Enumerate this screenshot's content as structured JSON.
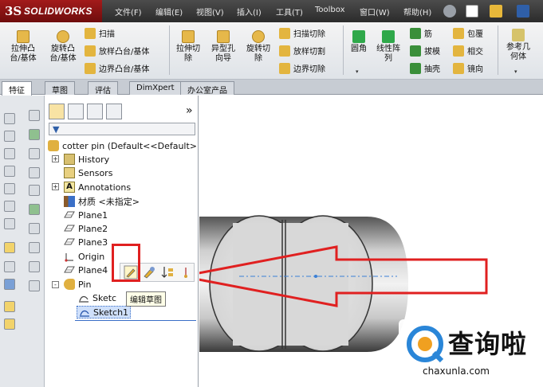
{
  "app": {
    "brand": "SOLIDWORKS",
    "brand_mark": "3S"
  },
  "menu": [
    {
      "label": "文件(F)"
    },
    {
      "label": "编辑(E)"
    },
    {
      "label": "视图(V)"
    },
    {
      "label": "插入(I)"
    },
    {
      "label": "工具(T)"
    },
    {
      "label": "Toolbox"
    },
    {
      "label": "窗口(W)"
    },
    {
      "label": "帮助(H)"
    }
  ],
  "ribbon": {
    "extrude_boss": "拉伸凸\n台/基体",
    "revolve_boss": "旋转凸\n台/基体",
    "sweep": "扫描",
    "loft_boss": "放样凸台/基体",
    "boundary_boss": "边界凸台/基体",
    "extrude_cut": "拉伸切\n除",
    "hole_wizard": "异型孔\n向导",
    "revolve_cut": "旋转切\n除",
    "sweep_cut": "扫描切除",
    "loft_cut": "放样切割",
    "boundary_cut": "边界切除",
    "fillet": "圆角",
    "linear_pattern": "线性阵\n列",
    "rib": "筋",
    "draft": "拔模",
    "shell": "抽壳",
    "wrap": "包覆",
    "intersect": "相交",
    "mirror": "镜向",
    "ref_geometry": "参考几\n何体",
    "dropdown_arrow": "▾"
  },
  "tabs": [
    {
      "label": "特征",
      "active": true
    },
    {
      "label": "草图"
    },
    {
      "label": "评估"
    },
    {
      "label": "DimXpert"
    },
    {
      "label": "办公室产品"
    }
  ],
  "feature_manager": {
    "expand_symbol": "»",
    "tree": [
      {
        "label": "cotter pin  (Default<<Default>",
        "icon": "part-icon"
      },
      {
        "label": "History",
        "icon": "history-icon",
        "expander": "+"
      },
      {
        "label": "Sensors",
        "icon": "sensors-icon"
      },
      {
        "label": "Annotations",
        "icon": "annotations-icon",
        "expander": "+"
      },
      {
        "label": "材质 <未指定>",
        "icon": "material-icon"
      },
      {
        "label": "Plane1",
        "icon": "plane-icon"
      },
      {
        "label": "Plane2",
        "icon": "plane-icon"
      },
      {
        "label": "Plane3",
        "icon": "plane-icon"
      },
      {
        "label": "Origin",
        "icon": "origin-icon"
      },
      {
        "label": "Plane4",
        "icon": "plane-icon"
      },
      {
        "label": "Pin",
        "icon": "feature-icon",
        "expander": "-"
      },
      {
        "label": "Sketc",
        "icon": "sketch-icon"
      },
      {
        "label": "Sketch1",
        "icon": "sketch-icon",
        "selected": true
      }
    ],
    "tooltip": "编辑草图"
  },
  "colors": {
    "accent_red": "#e02020",
    "selection": "#cfe0fb",
    "brand_red": "#a31b1b"
  },
  "watermark": {
    "cn": "查询啦",
    "url": "chaxunla.com"
  }
}
